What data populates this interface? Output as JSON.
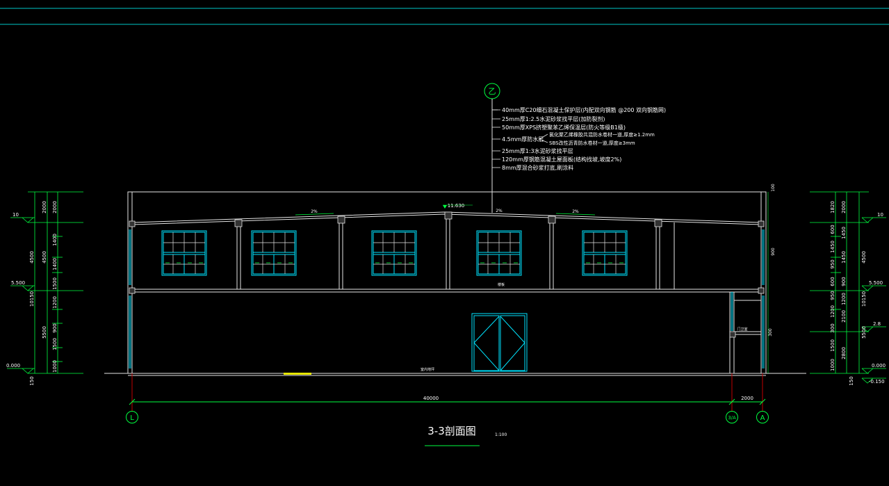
{
  "colors": {
    "background": "#000000",
    "frame": "#00c8c8",
    "wall": "#e6e6e6",
    "window": "#00e5ff",
    "dim": "#00ff40",
    "text": "#ffffff",
    "marker": "#e6e600"
  },
  "drawing": {
    "title": "3-3剖面图",
    "scale": "1:100",
    "top_axis": "乙",
    "axes_bottom": [
      "L",
      "3/A",
      "A"
    ],
    "roof_layers": [
      "40mm厚C20细石混凝土保护层(内配双向钢筋 @200 双向钢筋网)",
      "25mm厚1:2.5水泥砂浆找平层(加防裂剂)",
      "50mm厚XPS挤塑聚苯乙烯保温层(防火等级B1级)",
      "4.5mm厚防水层",
      "25mm厚1:3水泥砂浆找平层",
      "120mm厚钢筋混凝土屋面板(结构找坡,坡度2%)",
      "8mm厚混合砂浆打底,刷涂料"
    ],
    "roof_layer_notes": [
      "氯化聚乙烯橡胶共混防水卷材一道,厚度≥1.2mm",
      "SBS改性沥青防水卷材一道,厚度≥3mm"
    ],
    "ridge_elev": "11.630",
    "slope_left": "2%",
    "slope_right": "2%",
    "ridge_mark": "2%",
    "floor_label_lower": "室内地坪",
    "mid_label": "楼板",
    "room_label": "门卫室",
    "overall_dim": "40000",
    "right_dim": "2000",
    "left_levels": [
      "10",
      "5.500",
      "0.000"
    ],
    "left_dims_outer": [
      "4500",
      "10150",
      "5500",
      "150"
    ],
    "left_dims_mid": [
      "2000",
      "4500",
      "5500"
    ],
    "left_dims_inner": [
      "2000",
      "1400",
      "1400",
      "1500",
      "1200",
      "900",
      "1500",
      "1000"
    ],
    "right_levels": [
      "10",
      "5.500",
      "2.8",
      "0.000",
      "-0.150"
    ],
    "right_dims_outer": [
      "4500",
      "10150",
      "5500",
      "150"
    ],
    "right_dims_mid": [
      "2000",
      "1450",
      "1450",
      "900",
      "1200",
      "2100",
      "2800"
    ],
    "right_dims_inner": [
      "1820",
      "600",
      "1450",
      "950",
      "600",
      "950",
      "1200",
      "300",
      "1500",
      "1000"
    ],
    "right_wall_dims": [
      "100",
      "900",
      "300"
    ]
  }
}
